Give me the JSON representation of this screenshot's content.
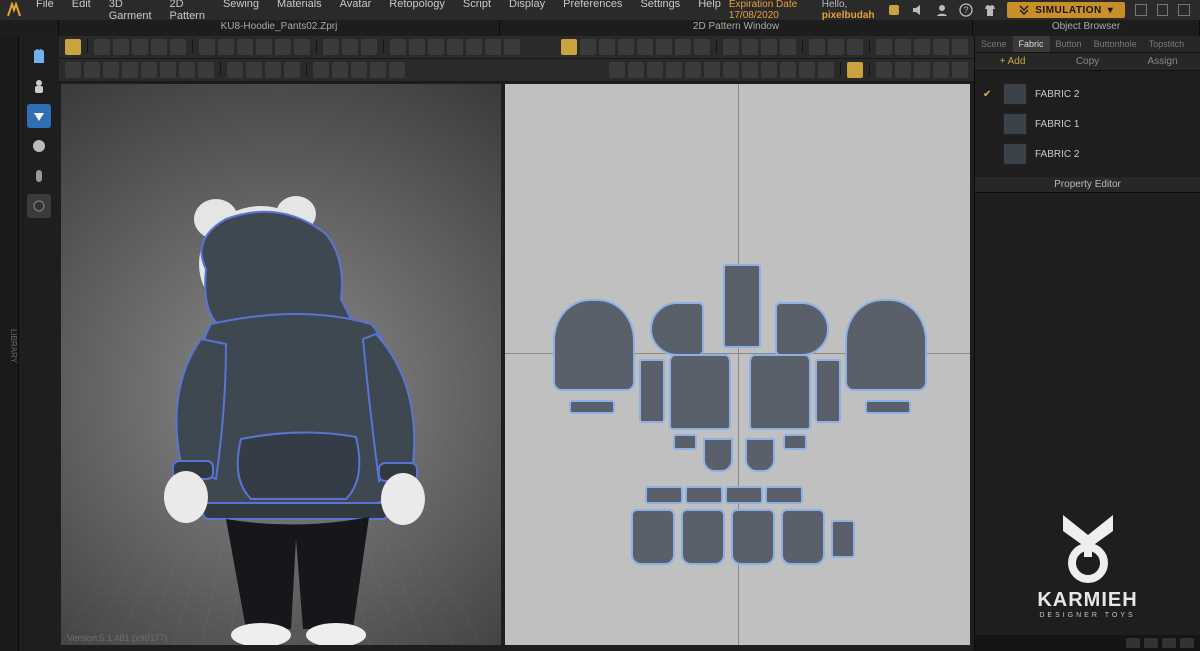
{
  "menu": [
    "File",
    "Edit",
    "3D Garment",
    "2D Pattern",
    "Sewing",
    "Materials",
    "Avatar",
    "Retopology",
    "Script",
    "Display",
    "Preferences",
    "Settings",
    "Help"
  ],
  "topright": {
    "expiration_label": "Expiration Date",
    "expiration_date": "17/08/2020",
    "hello": "Hello,",
    "user": "pixelbudah",
    "sim_label": "SIMULATION"
  },
  "titles": {
    "view3d": "KU8-Hoodie_Pants02.Zprj",
    "view2d": "2D Pattern Window",
    "object_browser": "Object Browser",
    "property_editor": "Property Editor"
  },
  "ob_tabs": [
    "Scene",
    "Fabric",
    "Button",
    "Buttonhole",
    "Topstitch"
  ],
  "ob_tab_active": 1,
  "ob_actions": {
    "add": "+  Add",
    "copy": "Copy",
    "assign": "Assign"
  },
  "fabrics": [
    {
      "name": "FABRIC 2",
      "checked": true
    },
    {
      "name": "FABRIC 1",
      "checked": false
    },
    {
      "name": "FABRIC 2",
      "checked": false
    }
  ],
  "status": {
    "version": "Version:5.1.481 (x90177)"
  },
  "brand": {
    "name": "KARMIEH",
    "tagline": "DESIGNER TOYS"
  },
  "icons": {
    "app": "app-logo",
    "notify": "notification-icon",
    "sound": "sound-icon",
    "user": "user-icon",
    "help": "help-icon",
    "tshirt": "tshirt-icon"
  }
}
